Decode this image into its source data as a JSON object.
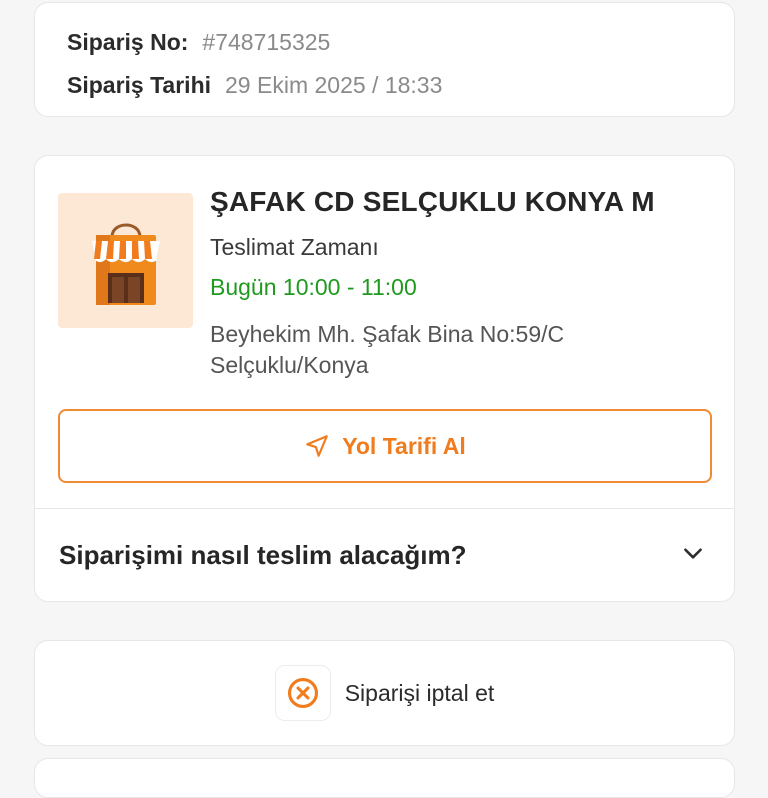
{
  "order": {
    "number_label": "Sipariş No:",
    "number_value": "#748715325",
    "date_label": "Sipariş Tarihi",
    "date_value": "29 Ekim 2025 / 18:33"
  },
  "store": {
    "name": "ŞAFAK CD SELÇUKLU KONYA M",
    "delivery_label": "Teslimat Zamanı",
    "delivery_time": "Bugün 10:00 - 11:00",
    "address_line1": "Beyhekim Mh. Şafak Bina No:59/C",
    "address_line2": "Selçuklu/Konya",
    "directions_label": "Yol Tarifi Al",
    "faq_question": "Siparişimi nasıl teslim alacağım?"
  },
  "cancel": {
    "label": "Siparişi iptal et"
  },
  "icons": {
    "store": "storefront-icon",
    "navigation": "navigation-arrow-icon",
    "chevron": "chevron-down-icon",
    "cancel": "cancel-circle-icon"
  },
  "colors": {
    "accent": "#f07c1e",
    "success": "#1f9a1f",
    "muted": "#8a8a8a"
  }
}
